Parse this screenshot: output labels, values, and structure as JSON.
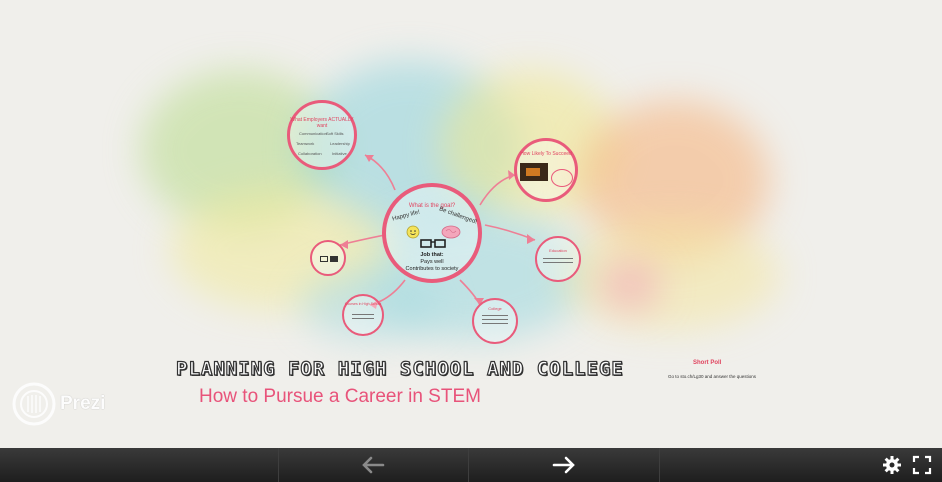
{
  "toolbar": {
    "prev_icon": "arrow-left-icon",
    "next_icon": "arrow-right-icon",
    "settings_icon": "gear-icon",
    "fullscreen_icon": "fullscreen-icon"
  },
  "logo": {
    "text": "Prezi"
  },
  "slide": {
    "title": "PLANNING FOR HIGH SCHOOL AND COLLEGE",
    "subtitle": "How to Pursue a Career in STEM",
    "center_title": "What is the goal?",
    "center_left": "Happy life!",
    "center_right": "Be challenged!",
    "center_job": "Job that:",
    "center_pays": "Pays well",
    "center_contrib": "Contributes to society",
    "employers_title": "What Employers ACTUALLY want",
    "employers_items": [
      "Communication",
      "Soft Skills",
      "Teamwork",
      "Leadership",
      "Collaboration",
      "Initiative"
    ],
    "how_likely_title": "How Likely To Succeed",
    "education_title": "Education",
    "college_title": "College",
    "high_school_title": "Courses in High School",
    "poll_title": "Short Poll",
    "poll_text": "Go to sto.ch/Lg30 and answer the questions"
  },
  "colors": {
    "accent": "#e95b7b",
    "toolbar": "#2a2a2a"
  }
}
